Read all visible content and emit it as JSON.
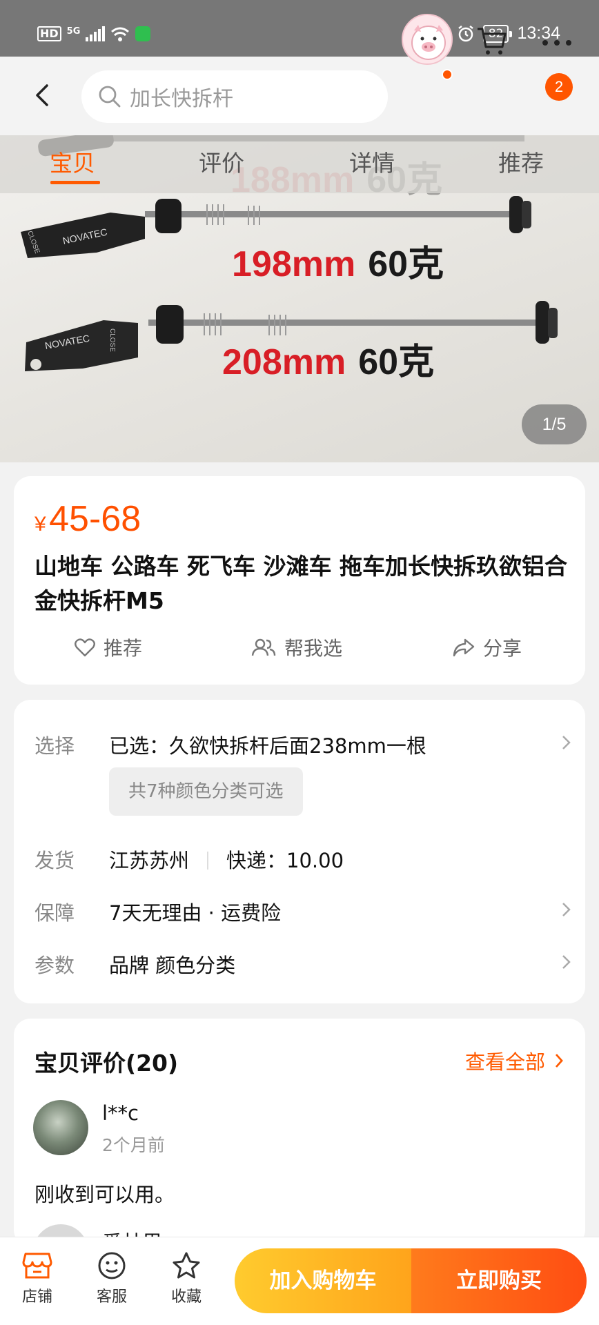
{
  "status_bar": {
    "hd": "HD",
    "network": "5G",
    "battery": "82",
    "time": "13:34"
  },
  "header": {
    "search_text": "加长快拆杆",
    "cart_badge": "2"
  },
  "tabs": [
    "宝贝",
    "评价",
    "详情",
    "推荐"
  ],
  "gallery": {
    "overlay_text": [
      "188mm",
      "60克",
      "198mm",
      "60克",
      "208mm",
      "60克"
    ],
    "brand_text": [
      "NOVATEC",
      "CLOSE",
      "NOVATEC",
      "CLOSE"
    ],
    "counter": "1/5"
  },
  "product": {
    "currency": "¥",
    "price": "45-68",
    "title": "山地车 公路车  死飞车 沙滩车 拖车加长快拆玖欲铝合金快拆杆M5",
    "actions": {
      "recommend": "推荐",
      "help_choose": "帮我选",
      "share": "分享"
    }
  },
  "specs": {
    "select_key": "选择",
    "select_val": "已选：久欲快拆杆后面238mm一根",
    "chip": "共7种颜色分类可选",
    "ship_key": "发货",
    "ship_origin": "江苏苏州",
    "ship_fee": "快递：10.00",
    "guarantee_key": "保障",
    "guarantee_val": "7天无理由 · 运费险",
    "params_key": "参数",
    "params_val": "品牌 颜色分类"
  },
  "reviews": {
    "title": "宝贝评价(20)",
    "see_all": "查看全部",
    "items": [
      {
        "name": "l**c",
        "time": "2个月前",
        "text": "刚收到可以用。"
      },
      {
        "name": "爱林里"
      }
    ]
  },
  "bottom_bar": {
    "shop": "店铺",
    "service": "客服",
    "favorite": "收藏",
    "add_to_cart": "加入购物车",
    "buy_now": "立即购买"
  },
  "colors": {
    "accent": "#ff5000",
    "cart_button": "#ffb21f",
    "buy_button": "#ff5a14"
  }
}
